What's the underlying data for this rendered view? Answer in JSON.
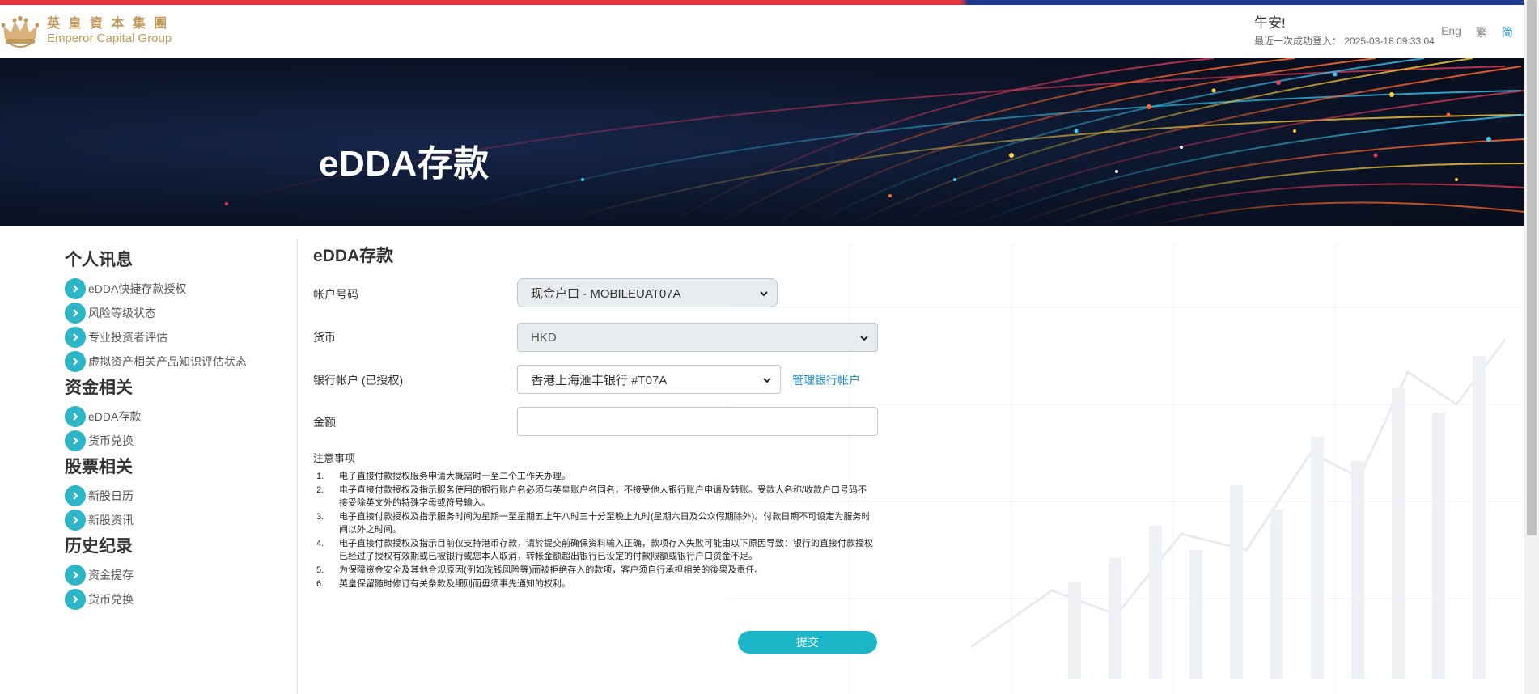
{
  "brand": {
    "name_cn": "英 皇 資 本 集 團",
    "name_en": "Emperor Capital Group"
  },
  "header": {
    "greeting": "午安!",
    "last_login_label": "最近一次成功登入：",
    "last_login_time": "2025-03-18 09:33:04",
    "languages": [
      {
        "label": "Eng",
        "active": false
      },
      {
        "label": "繁",
        "active": false
      },
      {
        "label": "简",
        "active": true
      }
    ]
  },
  "banner": {
    "title": "eDDA存款"
  },
  "sidebar": {
    "groups": [
      {
        "title": "个人讯息",
        "items": [
          "eDDA快捷存款授权",
          "风险等级状态",
          "专业投资者评估",
          "虚拟资产相关产品知识评估状态"
        ]
      },
      {
        "title": "资金相关",
        "items": [
          "eDDA存款",
          "货币兑换"
        ]
      },
      {
        "title": "股票相关",
        "items": [
          "新股日历",
          "新股资讯"
        ]
      },
      {
        "title": "历史纪录",
        "items": [
          "资金提存",
          "货币兑换"
        ]
      }
    ]
  },
  "form": {
    "title": "eDDA存款",
    "account_label": "帐户号码",
    "account_value": "现金户口 - MOBILEUAT07A",
    "currency_label": "货币",
    "currency_value": "HKD",
    "bank_label": "银行帐户 (已授权)",
    "bank_value": "香港上海滙丰银行 #T07A",
    "manage_bank_link": "管理银行帐户",
    "amount_label": "金额",
    "amount_value": "",
    "notes_title": "注意事项",
    "notes": [
      {
        "num": "1.",
        "text": "电子直接付款授权服务申请大概需时一至二个工作天办理。"
      },
      {
        "num": "2.",
        "text": "电子直接付款授权及指示服务使用的银行账户名必须与英皇账户名同名，不接受他人银行账户申请及转账。受款人名称/收款户口号码不接受除英文外的特殊字母或符号输入。"
      },
      {
        "num": "3.",
        "text": "电子直接付款授权及指示服务时间为星期一至星期五上午八时三十分至晚上九时(星期六日及公众假期除外)。付款日期不可设定为服务时间以外之时间。"
      },
      {
        "num": "4.",
        "text": "电子直接付款授权及指示目前仅支持港币存款，请於提交前确保资料输入正确，款项存入失败可能由以下原因导致：银行的直接付款授权已经过了授权有效期或已被银行或您本人取消，转帐金额超出银行已设定的付款限额或银行户口资金不足。"
      },
      {
        "num": "5.",
        "text": "为保障资金安全及其他合规原因(例如洗钱风险等)而被拒绝存入的款项，客户须自行承担相关的後果及责任。"
      },
      {
        "num": "6.",
        "text": "英皇保留随时修订有关条款及细则而毋须事先通知的权利。"
      }
    ],
    "submit_label": "提交"
  }
}
